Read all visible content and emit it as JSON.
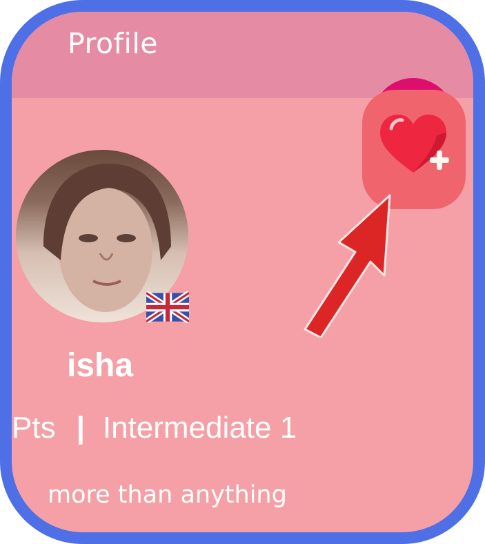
{
  "header": {
    "title": "Profile"
  },
  "favorite_button": {
    "icon": "heart-plus-icon"
  },
  "profile": {
    "avatar": "user-photo",
    "language_flag": "uk-flag-icon",
    "name": "isha",
    "points_label": "Pts",
    "divider": "|",
    "level": "Intermediate 1",
    "bio": "more than anything"
  },
  "annotation": {
    "arrow": "red-arrow-pointing-to-favorite-button"
  },
  "colors": {
    "frame": "#4f6fe6",
    "background": "#f4a0a6",
    "header": "#e68ba4",
    "favorite_button": "#f0646e",
    "arrow": "#dc2626"
  }
}
